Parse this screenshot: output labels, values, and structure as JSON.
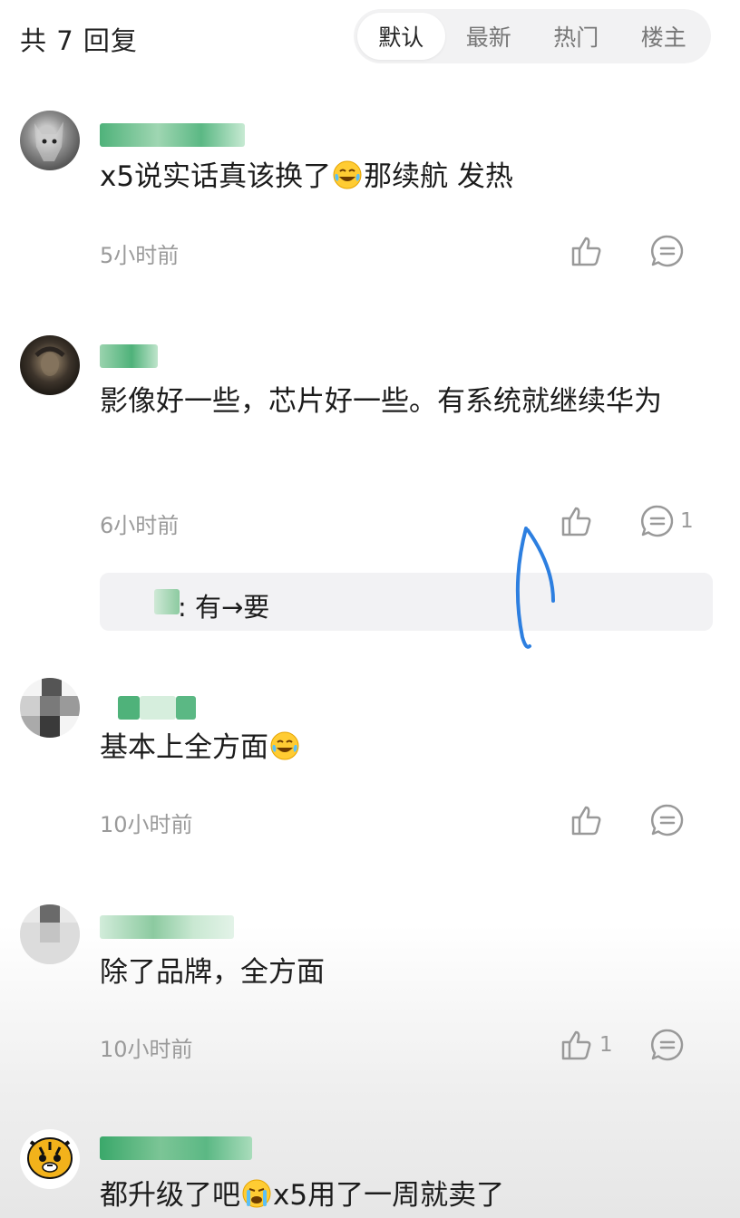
{
  "header": {
    "reply_count": "共 7 回复",
    "tabs": [
      "默认",
      "最新",
      "热门",
      "楼主"
    ],
    "active_tab": "默认"
  },
  "colors": {
    "username_green": "#3aa86a",
    "muted": "#9a9a9a",
    "tab_bg": "#f2f2f3"
  },
  "comments": [
    {
      "username": "",
      "text_before": "x5说实话真该换了",
      "emoji": "laugh-cry-emoji",
      "text_after": "那续航 发热",
      "time": "5小时前",
      "likes": "",
      "replies": ""
    },
    {
      "username": "",
      "text": "影像好一些，芯片好一些。有系统就继续华为",
      "time": "6小时前",
      "likes": "",
      "replies": "1",
      "reply": {
        "text": ": 有→要"
      }
    },
    {
      "username": "",
      "text": "基本上全方面",
      "emoji": "laugh-cry-emoji",
      "time": "10小时前",
      "likes": "",
      "replies": ""
    },
    {
      "username": "",
      "text": "除了品牌，全方面",
      "time": "10小时前",
      "likes": "1",
      "replies": ""
    },
    {
      "username": "",
      "text_before": "都升级了吧",
      "emoji": "crying-emoji",
      "text_after": "x5用了一周就卖了"
    }
  ]
}
